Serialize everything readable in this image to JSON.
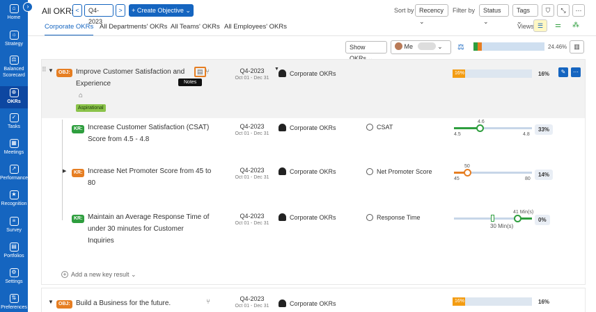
{
  "sidebar": {
    "items": [
      {
        "label": "Home",
        "icon": "home-icon",
        "glyph": "⌂"
      },
      {
        "label": "Strategy",
        "icon": "strategy-icon",
        "glyph": "☼"
      },
      {
        "label": "Balanced Scorecard",
        "icon": "scorecard-icon",
        "glyph": "⚖"
      },
      {
        "label": "OKRs",
        "icon": "target-icon",
        "glyph": "⊕"
      },
      {
        "label": "Tasks",
        "icon": "tasks-icon",
        "glyph": "✓"
      },
      {
        "label": "Meetings",
        "icon": "calendar-icon",
        "glyph": "▦"
      },
      {
        "label": "Performance",
        "icon": "performance-icon",
        "glyph": "↗"
      },
      {
        "label": "Recognition",
        "icon": "recognition-icon",
        "glyph": "★"
      },
      {
        "label": "Survey",
        "icon": "survey-icon",
        "glyph": "≡"
      },
      {
        "label": "Portfolios",
        "icon": "portfolio-icon",
        "glyph": "▤"
      },
      {
        "label": "Settings",
        "icon": "gear-icon",
        "glyph": "⚙"
      },
      {
        "label": "Preferences",
        "icon": "preferences-icon",
        "glyph": "⇅"
      }
    ],
    "toggle": "›"
  },
  "header": {
    "title": "All OKRs",
    "period": "Q4-2023",
    "prev": "<",
    "next": ">",
    "create": "+ Create Objective ⌄",
    "sort_label": "Sort by",
    "sort_value": "Recency ⌄",
    "filter_label": "Filter by",
    "status": "Status ⌄",
    "tags": "Tags ⌄",
    "views_label": "Views"
  },
  "tabs": [
    "Corporate OKRs",
    "All Departments' OKRs",
    "All Teams' OKRs",
    "All Employees' OKRs"
  ],
  "summary": {
    "show_okrs": "Show OKRs ⌄",
    "me": "Me",
    "overall_pct": "24.46%",
    "green_fraction": 0.06,
    "orange_fraction": 0.06
  },
  "objectives": [
    {
      "badge": "OBJ:",
      "title_line1": "Improve Customer Satisfaction and",
      "title_line2": "Experience",
      "tag": "Aspirational",
      "period": "Q4-2023",
      "range": "Oct 01 - Dec 31",
      "owner": "Corporate OKRs",
      "progress": 16,
      "progress_label": "16%",
      "pct": "16%",
      "tooltip": "Notes",
      "key_results": [
        {
          "badge": "KR:",
          "title_line1": "Increase Customer Satisfaction (CSAT)",
          "title_line2": "Score from 4.5 - 4.8",
          "title_line3": "",
          "period": "Q4-2023",
          "range": "Oct 01 - Dec 31",
          "owner": "Corporate OKRs",
          "metric": "CSAT",
          "start": "4.5",
          "end": "4.8",
          "current": "4.6",
          "pct": "33%",
          "color": "#2e9e3e"
        },
        {
          "badge": "KR:",
          "title_line1": "Increase Net Promoter Score from 45 to",
          "title_line2": "80",
          "title_line3": "",
          "period": "Q4-2023",
          "range": "Oct 01 - Dec 31",
          "owner": "Corporate OKRs",
          "metric": "Net Promoter Score",
          "start": "45",
          "end": "80",
          "current": "50",
          "pct": "14%",
          "color": "#e67e22"
        },
        {
          "badge": "KR:",
          "title_line1": "Maintain an Average Response Time of",
          "title_line2": "under 30 minutes for Customer",
          "title_line3": "Inquiries",
          "period": "Q4-2023",
          "range": "Oct 01 - Dec 31",
          "owner": "Corporate OKRs",
          "metric": "Response Time",
          "start": "",
          "end": "30 Min(s)",
          "current": "41 Min(s)",
          "pct": "0%",
          "color": "#2e9e3e"
        }
      ],
      "add_kr": "Add a new key result ⌄"
    },
    {
      "badge": "OBJ:",
      "title_line1": "Build a Business for the future.",
      "period": "Q4-2023",
      "range": "Oct 01 - Dec 31",
      "owner": "Corporate OKRs",
      "progress": 16,
      "progress_label": "16%",
      "pct": "16%"
    }
  ],
  "colors": {
    "brand": "#1565c0",
    "orange": "#e67e22",
    "green": "#2e9e3e"
  }
}
